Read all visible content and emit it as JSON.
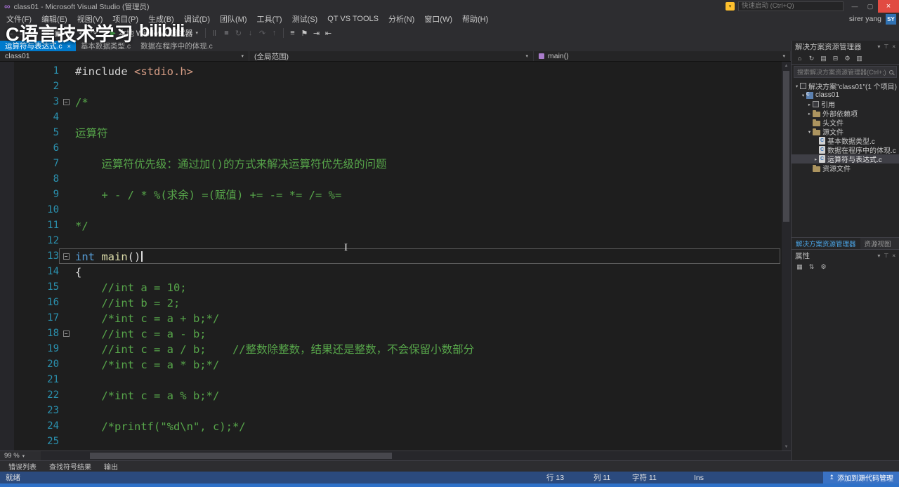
{
  "glyphs": {
    "chevron_down": "▾",
    "arrow_right": "▸",
    "arrow_down": "▾",
    "close": "×",
    "play": "▶",
    "minus": "−",
    "scroll_up": "▲",
    "scroll_down": "▼",
    "upload": "↥",
    "c_letter": "C",
    "vs_logo": "∞",
    "flag": "▾",
    "ibeam": "I"
  },
  "title_bar": {
    "title": "class01 - Microsoft Visual Studio (管理员)",
    "quick_launch_placeholder": "快速启动 (Ctrl+Q)",
    "window_controls": [
      {
        "name": "minimize-button",
        "glyph": "—"
      },
      {
        "name": "maximize-button",
        "glyph": "▢"
      },
      {
        "name": "close-button",
        "glyph": "×",
        "danger": true
      }
    ]
  },
  "account": {
    "user_name": "sirer yang",
    "avatar_initials": "SY"
  },
  "menu_bar": [
    "文件(F)",
    "编辑(E)",
    "视图(V)",
    "项目(P)",
    "生成(B)",
    "调试(D)",
    "团队(M)",
    "工具(T)",
    "测试(S)",
    "QT VS TOOLS",
    "分析(N)",
    "窗口(W)",
    "帮助(H)"
  ],
  "toolbar": {
    "run_button": {
      "label": "本地 Windows 调试器"
    },
    "icons_left": [
      {
        "name": "navigate-back-icon",
        "glyph": "←"
      },
      {
        "name": "navigate-forward-icon",
        "glyph": "→"
      },
      {
        "name": "new-file-icon",
        "glyph": "▢"
      },
      {
        "name": "open-file-icon",
        "glyph": "▭"
      },
      {
        "name": "save-icon",
        "glyph": "▣"
      },
      {
        "name": "save-all-icon",
        "glyph": "⊞"
      },
      {
        "name": "undo-icon",
        "glyph": "↶"
      },
      {
        "name": "redo-icon",
        "glyph": "↷"
      }
    ],
    "icons_debug": [
      {
        "name": "break-all-icon",
        "glyph": "Ⅱ",
        "dim": true
      },
      {
        "name": "stop-debug-icon",
        "glyph": "■",
        "dim": true
      },
      {
        "name": "restart-icon",
        "glyph": "↻",
        "dim": true
      },
      {
        "name": "step-into-icon",
        "glyph": "↓",
        "dim": true
      },
      {
        "name": "step-over-icon",
        "glyph": "↷",
        "dim": true
      },
      {
        "name": "step-out-icon",
        "glyph": "↑",
        "dim": true
      }
    ],
    "icons_editor": [
      {
        "name": "comment-icon",
        "glyph": "≡"
      },
      {
        "name": "bookmark-icon",
        "glyph": "⚑"
      },
      {
        "name": "indent-icon",
        "glyph": "⇥"
      },
      {
        "name": "outdent-icon",
        "glyph": "⇤"
      }
    ]
  },
  "tabs": [
    {
      "label": "运算符与表达式.c",
      "active": true
    },
    {
      "label": "基本数据类型.c",
      "active": false
    },
    {
      "label": "数据在程序中的体现.c",
      "active": false
    }
  ],
  "navigation_bar": {
    "project": "class01",
    "scope": "(全局范围)",
    "member": "main()"
  },
  "editor": {
    "zoom_level": "99 %",
    "lines": [
      {
        "n": 1,
        "seg": [
          [
            "pp",
            "#include "
          ],
          [
            "str",
            "<stdio.h>"
          ]
        ]
      },
      {
        "n": 2,
        "seg": []
      },
      {
        "n": 3,
        "fold": true,
        "seg": [
          [
            "cmt",
            "/*"
          ]
        ]
      },
      {
        "n": 4,
        "seg": []
      },
      {
        "n": 5,
        "seg": [
          [
            "cmt",
            "运算符"
          ]
        ]
      },
      {
        "n": 6,
        "seg": []
      },
      {
        "n": 7,
        "seg": [
          [
            "cmt",
            "    运算符优先级：通过加()的方式来解决运算符优先级的问题"
          ]
        ]
      },
      {
        "n": 8,
        "seg": []
      },
      {
        "n": 9,
        "seg": [
          [
            "cmt",
            "    + - / * %(求余) =(赋值) += -= *= /= %="
          ]
        ]
      },
      {
        "n": 10,
        "seg": []
      },
      {
        "n": 11,
        "seg": [
          [
            "cmt",
            "*/"
          ]
        ]
      },
      {
        "n": 12,
        "seg": []
      },
      {
        "n": 13,
        "fold": true,
        "current": true,
        "caret": true,
        "seg": [
          [
            "kw",
            "int"
          ],
          [
            "pln",
            " "
          ],
          [
            "fn",
            "main"
          ],
          [
            "pln",
            "()"
          ]
        ]
      },
      {
        "n": 14,
        "seg": [
          [
            "pln",
            "{"
          ]
        ]
      },
      {
        "n": 15,
        "seg": [
          [
            "pln",
            "    "
          ],
          [
            "cmt",
            "//int a = 10;"
          ]
        ]
      },
      {
        "n": 16,
        "seg": [
          [
            "pln",
            "    "
          ],
          [
            "cmt",
            "//int b = 2;"
          ]
        ]
      },
      {
        "n": 17,
        "seg": [
          [
            "pln",
            "    "
          ],
          [
            "cmt",
            "/*int c = a + b;*/"
          ]
        ]
      },
      {
        "n": 18,
        "fold": true,
        "seg": [
          [
            "pln",
            "    "
          ],
          [
            "cmt",
            "//int c = a - b;"
          ]
        ]
      },
      {
        "n": 19,
        "seg": [
          [
            "pln",
            "    "
          ],
          [
            "cmt",
            "//int c = a / b;    //整数除整数，结果还是整数，不会保留小数部分"
          ]
        ]
      },
      {
        "n": 20,
        "seg": [
          [
            "pln",
            "    "
          ],
          [
            "cmt",
            "/*int c = a * b;*/"
          ]
        ]
      },
      {
        "n": 21,
        "seg": []
      },
      {
        "n": 22,
        "seg": [
          [
            "pln",
            "    "
          ],
          [
            "cmt",
            "/*int c = a % b;*/"
          ]
        ]
      },
      {
        "n": 23,
        "seg": []
      },
      {
        "n": 24,
        "seg": [
          [
            "pln",
            "    "
          ],
          [
            "cmt",
            "/*printf(\"%d\\n\", c);*/"
          ]
        ]
      },
      {
        "n": 25,
        "seg": []
      }
    ]
  },
  "solution_explorer": {
    "title": "解决方案资源管理器",
    "header_icons": [
      {
        "name": "panel-menu-icon",
        "glyph": "▾"
      },
      {
        "name": "pin-icon",
        "glyph": "⊤"
      },
      {
        "name": "close-icon",
        "glyph": "×"
      }
    ],
    "toolbar_icons": [
      {
        "name": "home-icon",
        "glyph": "⌂"
      },
      {
        "name": "refresh-icon",
        "glyph": "↻"
      },
      {
        "name": "show-all-files-icon",
        "glyph": "▤"
      },
      {
        "name": "collapse-all-icon",
        "glyph": "⊟"
      },
      {
        "name": "properties-icon",
        "glyph": "⚙"
      },
      {
        "name": "preview-icon",
        "glyph": "▥"
      }
    ],
    "search_placeholder": "搜索解决方案资源管理器(Ctrl+;)",
    "tree": [
      {
        "label": "解决方案\"class01\"(1 个项目)",
        "icon": "solution",
        "indent": 0,
        "arrow": "down"
      },
      {
        "label": "class01",
        "icon": "project",
        "indent": 1,
        "arrow": "down"
      },
      {
        "label": "引用",
        "icon": "references",
        "indent": 2,
        "arrow": "right"
      },
      {
        "label": "外部依赖项",
        "icon": "folder",
        "indent": 2,
        "arrow": "right"
      },
      {
        "label": "头文件",
        "icon": "folder",
        "indent": 2,
        "arrow": ""
      },
      {
        "label": "源文件",
        "icon": "folder",
        "indent": 2,
        "arrow": "down"
      },
      {
        "label": "基本数据类型.c",
        "icon": "c-file",
        "indent": 3,
        "arrow": ""
      },
      {
        "label": "数据在程序中的体现.c",
        "icon": "c-file",
        "indent": 3,
        "arrow": ""
      },
      {
        "label": "运算符与表达式.c",
        "icon": "c-file",
        "indent": 3,
        "arrow": "right",
        "selected": true
      },
      {
        "label": "资源文件",
        "icon": "folder",
        "indent": 2,
        "arrow": ""
      }
    ],
    "bottom_tabs": [
      {
        "label": "解决方案资源管理器",
        "active": true
      },
      {
        "label": "资源视图",
        "active": false
      }
    ]
  },
  "properties_panel": {
    "title": "属性",
    "header_icons": [
      {
        "name": "panel-menu-icon",
        "glyph": "▾"
      },
      {
        "name": "pin-icon",
        "glyph": "⊤"
      },
      {
        "name": "close-icon",
        "glyph": "×"
      }
    ],
    "toolbar_icons": [
      {
        "name": "categorized-icon",
        "glyph": "▦"
      },
      {
        "name": "alphabetical-icon",
        "glyph": "⇅"
      },
      {
        "name": "property-pages-icon",
        "glyph": "⚙"
      }
    ]
  },
  "bottom_panel_tabs": [
    "错误列表",
    "查找符号结果",
    "输出"
  ],
  "status_bar": {
    "message": "就绪",
    "line": "行 13",
    "column": "列 11",
    "character": "字符 11",
    "insert_mode": "Ins",
    "source_control_label": "添加到源代码管理"
  },
  "watermark": {
    "title": "C语言技术学习",
    "logo_text": "bilibili"
  }
}
